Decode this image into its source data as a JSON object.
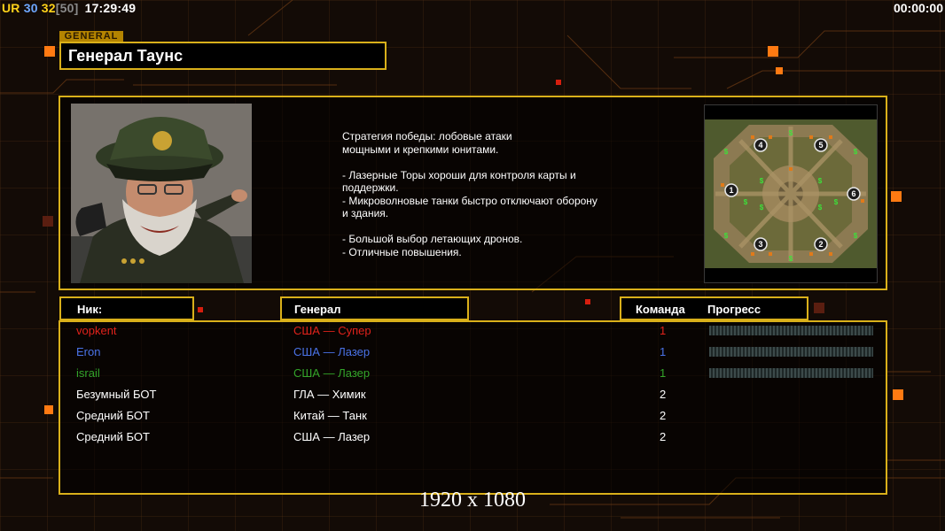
{
  "hud": {
    "ur": "UR",
    "v1": "30",
    "v2": "32",
    "v3": "[50]",
    "clock": "17:29:49",
    "timer": "00:00:00"
  },
  "general": {
    "tag": "GENERAL",
    "name": "Генерал Таунс",
    "strategy": "Стратегия победы: лобовые атаки\nмощными и крепкими юнитами.\n\n- Лазерные Торы хороши для контроля карты и\n поддержки.\n- Микроволновые танки быстро отключают оборону\n и здания.\n\n- Большой выбор летающих дронов.\n- Отличные повышения."
  },
  "map": {
    "start_positions": [
      "1",
      "2",
      "3",
      "4",
      "5",
      "6"
    ],
    "supply_icon": "dollar-sign"
  },
  "table": {
    "headers": {
      "nick": "Ник:",
      "general": "Генерал",
      "team": "Команда",
      "progress": "Прогресс"
    },
    "rows": [
      {
        "nick": "vopkent",
        "general": "США — Супер",
        "team": "1",
        "color": "#e0221b",
        "progress": 0
      },
      {
        "nick": "Eron",
        "general": "США — Лазер",
        "team": "1",
        "color": "#4a73e8",
        "progress": 0
      },
      {
        "nick": "israil",
        "general": "США — Лазер",
        "team": "1",
        "color": "#33a52a",
        "progress": 0
      },
      {
        "nick": "Безумный БОТ",
        "general": "ГЛА — Химик",
        "team": "2",
        "color": "#ffffff"
      },
      {
        "nick": "Средний БОТ",
        "general": "Китай — Танк",
        "team": "2",
        "color": "#ffffff"
      },
      {
        "nick": "Средний БОТ",
        "general": "США — Лазер",
        "team": "2",
        "color": "#ffffff"
      }
    ]
  },
  "resolution_label": "1920 x 1080",
  "colors": {
    "accent": "#d9b01a",
    "orange": "#ff7a12",
    "background": "#130b06"
  }
}
